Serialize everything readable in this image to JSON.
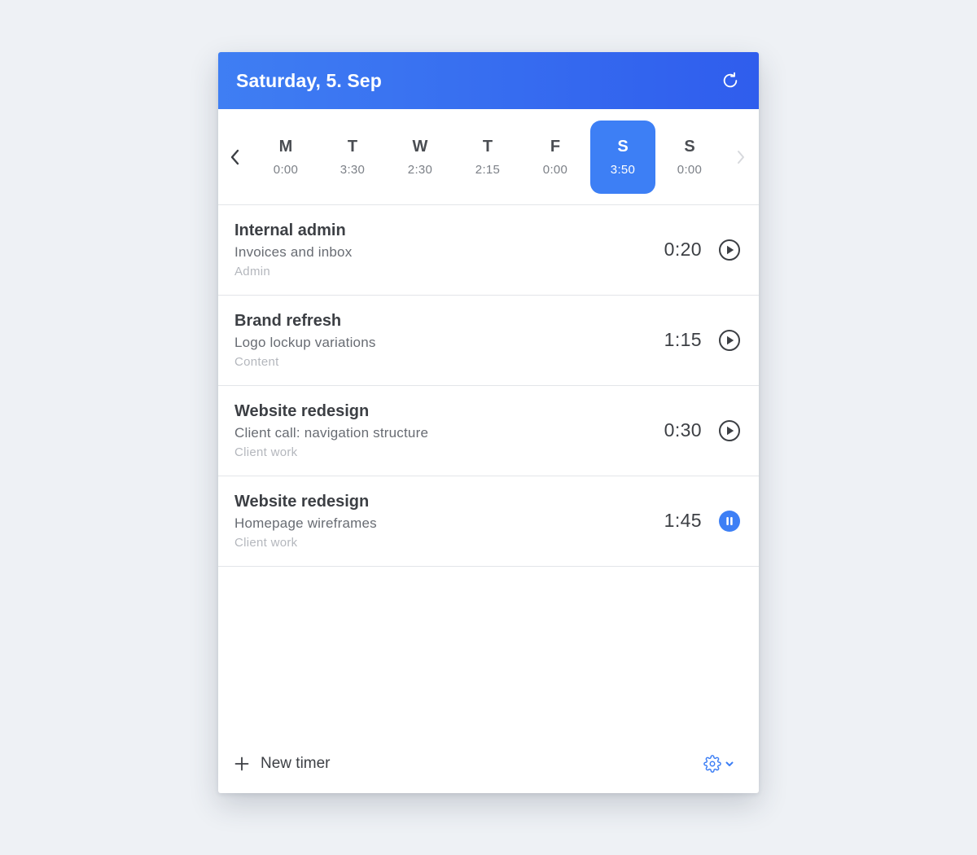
{
  "header": {
    "title": "Saturday, 5. Sep",
    "refresh_icon": "refresh-icon"
  },
  "week": {
    "prev_icon": "chevron-left-icon",
    "next_icon": "chevron-right-icon",
    "days": [
      {
        "letter": "M",
        "time": "0:00",
        "active": false
      },
      {
        "letter": "T",
        "time": "3:30",
        "active": false
      },
      {
        "letter": "W",
        "time": "2:30",
        "active": false
      },
      {
        "letter": "T",
        "time": "2:15",
        "active": false
      },
      {
        "letter": "F",
        "time": "0:00",
        "active": false
      },
      {
        "letter": "S",
        "time": "3:50",
        "active": true
      },
      {
        "letter": "S",
        "time": "0:00",
        "active": false
      }
    ]
  },
  "entries": [
    {
      "project": "Internal admin",
      "task": "Invoices and inbox",
      "category": "Admin",
      "duration": "0:20",
      "state": "play"
    },
    {
      "project": "Brand refresh",
      "task": "Logo lockup variations",
      "category": "Content",
      "duration": "1:15",
      "state": "play"
    },
    {
      "project": "Website redesign",
      "task": "Client call: navigation structure",
      "category": "Client work",
      "duration": "0:30",
      "state": "play"
    },
    {
      "project": "Website redesign",
      "task": "Homepage wireframes",
      "category": "Client work",
      "duration": "1:45",
      "state": "running"
    }
  ],
  "footer": {
    "new_timer_label": "New timer",
    "plus_icon": "plus-icon",
    "settings_icon": "gear-icon",
    "dropdown_icon": "chevron-down-icon"
  },
  "colors": {
    "accent": "#3d7ff5",
    "header_start": "#3f7ef3",
    "header_end": "#2f5ded",
    "text_primary": "#3c3f44",
    "text_secondary": "#686c73",
    "text_muted": "#b4b7bd"
  }
}
